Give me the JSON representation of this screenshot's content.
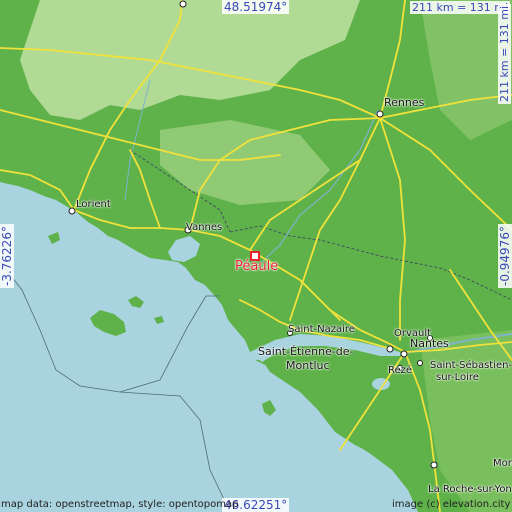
{
  "map": {
    "highlighted_town": "Péaule",
    "coords": {
      "top": "48.51974°",
      "bottom": "46.62251°",
      "left": "-3.76226°",
      "right": "-0.94976°"
    },
    "scale_label": "211 km = 131 mi",
    "cities": {
      "rennes": "Rennes",
      "lorient": "Lorient",
      "vannes": "Vannes",
      "saint_nazaire": "Saint-Nazaire",
      "saint_etienne_1": "Saint-Étienne-de-",
      "saint_etienne_2": "Montluc",
      "orvault": "Orvault",
      "nantes": "Nantes",
      "reze": "Rezé",
      "saint_sebastien_1": "Saint-Sébastien-",
      "saint_sebastien_2": "sur-Loire",
      "la_roche": "La Roche-sur-Yon",
      "mon": "Mon"
    },
    "attribution_left": "map data: openstreetmap, style: opentopomap",
    "attribution_right": "image (c) elevation.city",
    "colors": {
      "sea": "#a9d3df",
      "land_green": "#5fb24a",
      "land_light": "#bfe0a2",
      "road": "#f1e23b",
      "highlight": "#e8232f"
    }
  }
}
